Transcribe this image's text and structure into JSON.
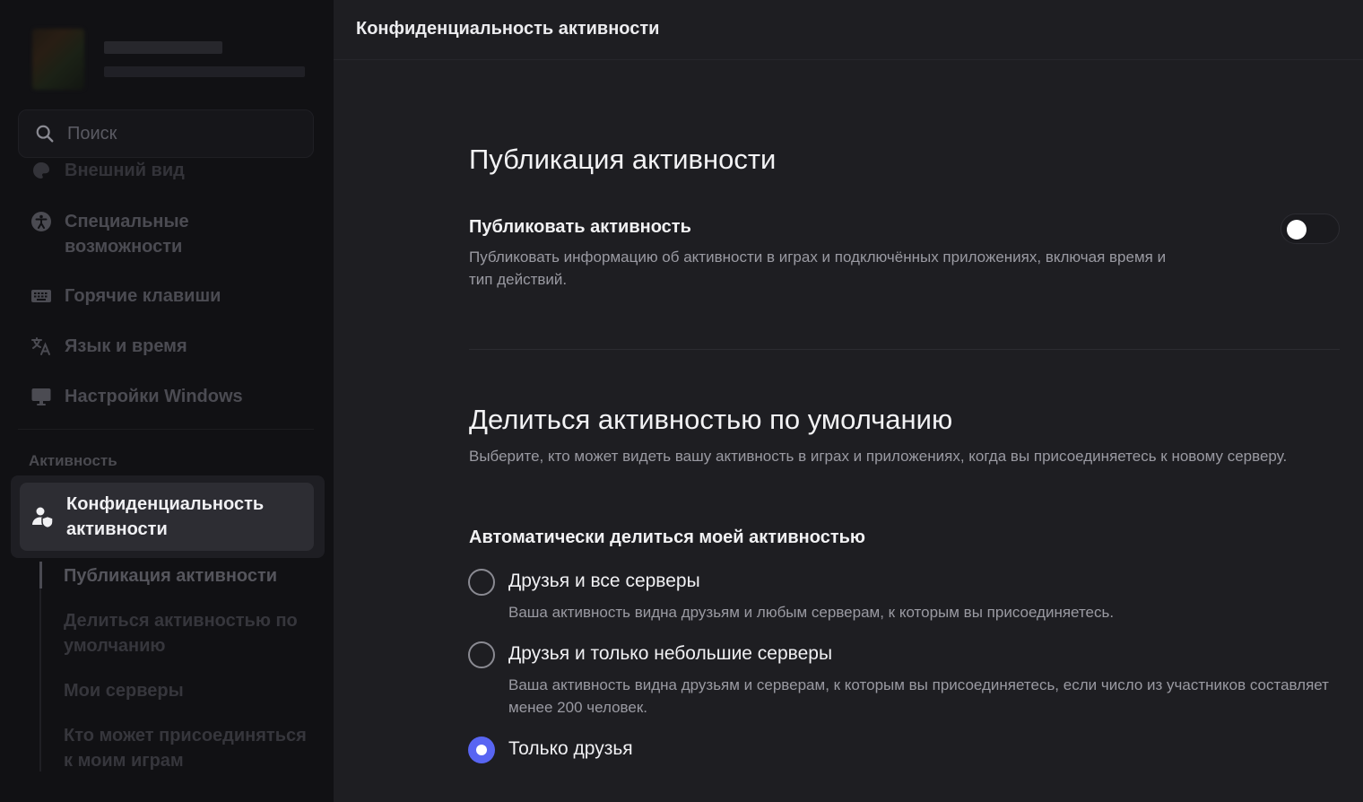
{
  "sidebar": {
    "search": {
      "placeholder": "Поиск"
    },
    "items": [
      {
        "label": "Внешний вид",
        "icon": "palette-icon"
      },
      {
        "label": "Специальные возможности",
        "icon": "accessibility-icon"
      },
      {
        "label": "Горячие клавиши",
        "icon": "keyboard-icon"
      },
      {
        "label": "Язык и время",
        "icon": "translate-icon"
      },
      {
        "label": "Настройки Windows",
        "icon": "monitor-icon"
      }
    ],
    "section_label": "Активность",
    "active_item": {
      "label": "Конфиденциальность активности",
      "icon": "user-shield-icon"
    },
    "sub_items": [
      {
        "label": "Публикация активности"
      },
      {
        "label": "Делиться активностью по умолчанию"
      },
      {
        "label": "Мои серверы"
      },
      {
        "label": "Кто может присоединяться к моим играм"
      }
    ]
  },
  "header": {
    "title": "Конфиденциальность активности"
  },
  "publication": {
    "heading": "Публикация активности",
    "setting_title": "Публиковать активность",
    "setting_desc": "Публиковать информацию об активности в играх и подключённых приложениях, включая время и тип действий.",
    "enabled": false
  },
  "default_sharing": {
    "heading": "Делиться активностью по умолчанию",
    "desc": "Выберите, кто может видеть вашу активность в играх и приложениях, когда вы присоединяетесь к новому серверу.",
    "group_title": "Автоматически делиться моей активностью",
    "options": [
      {
        "label": "Друзья и все серверы",
        "desc": "Ваша активность видна друзьям и любым серверам, к которым вы присоединяетесь.",
        "checked": false
      },
      {
        "label": "Друзья и только небольшие серверы",
        "desc": "Ваша активность видна друзьям и серверам, к которым вы присоединяетесь, если число из участников составляет менее 200 человек.",
        "checked": false
      },
      {
        "label": "Только друзья",
        "desc": "",
        "checked": true
      }
    ]
  },
  "colors": {
    "accent": "#5865f2",
    "background": "#1e1e22",
    "sidebar": "#111114"
  }
}
